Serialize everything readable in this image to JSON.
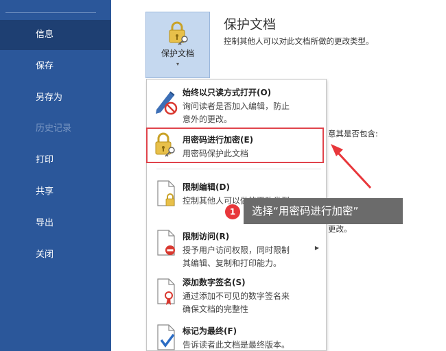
{
  "sidebar": {
    "items": [
      {
        "label": "信息",
        "state": "active"
      },
      {
        "label": "保存",
        "state": "normal"
      },
      {
        "label": "另存为",
        "state": "normal"
      },
      {
        "label": "历史记录",
        "state": "disabled"
      },
      {
        "label": "打印",
        "state": "normal"
      },
      {
        "label": "共享",
        "state": "normal"
      },
      {
        "label": "导出",
        "state": "normal"
      },
      {
        "label": "关闭",
        "state": "normal"
      }
    ]
  },
  "protect": {
    "button_label": "保护文档",
    "title": "保护文档",
    "description": "控制其他人可以对此文档所做的更改类型。"
  },
  "background_text": {
    "line1": "意其是否包含:",
    "line2": "更改。"
  },
  "menu": {
    "items": [
      {
        "title": "始终以只读方式打开(O)",
        "desc1": "询问读者是否加入编辑，防止",
        "desc2": "意外的更改。",
        "icon": "pencil-no-icon"
      },
      {
        "title": "用密码进行加密(E)",
        "desc1": "用密码保护此文档",
        "icon": "lock-key-icon"
      },
      {
        "title": "限制编辑(D)",
        "desc1": "控制其他人可以做的更改类型",
        "icon": "document-lock-icon"
      },
      {
        "title": "限制访问(R)",
        "desc1": "授予用户访问权限，同时限制",
        "desc2": "其编辑、复制和打印能力。",
        "icon": "document-restrict-icon",
        "submenu": true
      },
      {
        "title": "添加数字签名(S)",
        "desc1": "通过添加不可见的数字签名来",
        "desc2": "确保文档的完整性",
        "icon": "document-ribbon-icon"
      },
      {
        "title": "标记为最终(F)",
        "desc1": "告诉读者此文档是最终版本。",
        "icon": "document-check-icon"
      }
    ]
  },
  "callout": {
    "step": "1",
    "text": "选择“用密码进行加密”"
  },
  "colors": {
    "sidebar_bg": "#2b579a",
    "sidebar_active": "#1e3f72",
    "highlight": "#e0434b",
    "callout_bg": "#6b6b6b",
    "badge": "#e8373b"
  }
}
